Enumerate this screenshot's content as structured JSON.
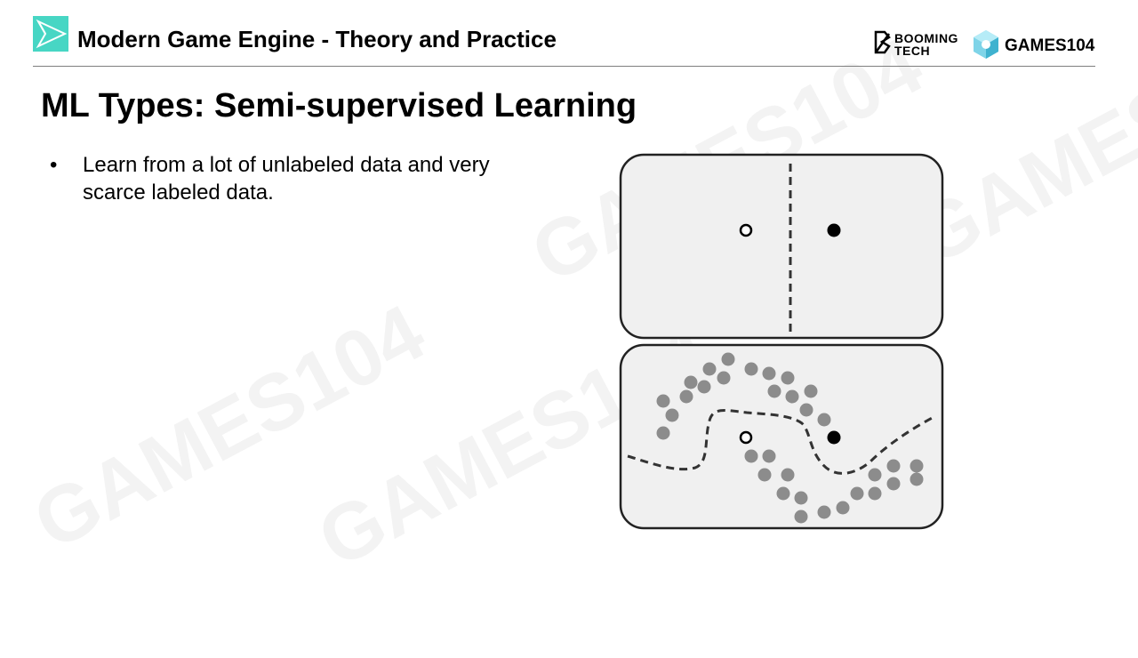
{
  "header": {
    "course_title": "Modern Game Engine - Theory and Practice",
    "brand_booming": "BOOMING\nTECH",
    "brand_games": "GAMES104",
    "logo_icon": "play-triangle-icon",
    "accent_color": "#47d6c4"
  },
  "slide": {
    "title": "ML Types: Semi-supervised Learning",
    "bullets": [
      {
        "marker": "•",
        "text": "Learn from a lot of unlabeled data and very scarce labeled data."
      }
    ]
  },
  "diagram": {
    "panels": [
      {
        "name": "labeled-only",
        "labeled_points": [
          "unfilled",
          "filled"
        ],
        "boundary": "vertical-dashed"
      },
      {
        "name": "with-unlabeled",
        "labeled_points": [
          "unfilled",
          "filled"
        ],
        "boundary": "curved-dashed",
        "unlabeled_color": "#8c8c8c"
      }
    ]
  }
}
